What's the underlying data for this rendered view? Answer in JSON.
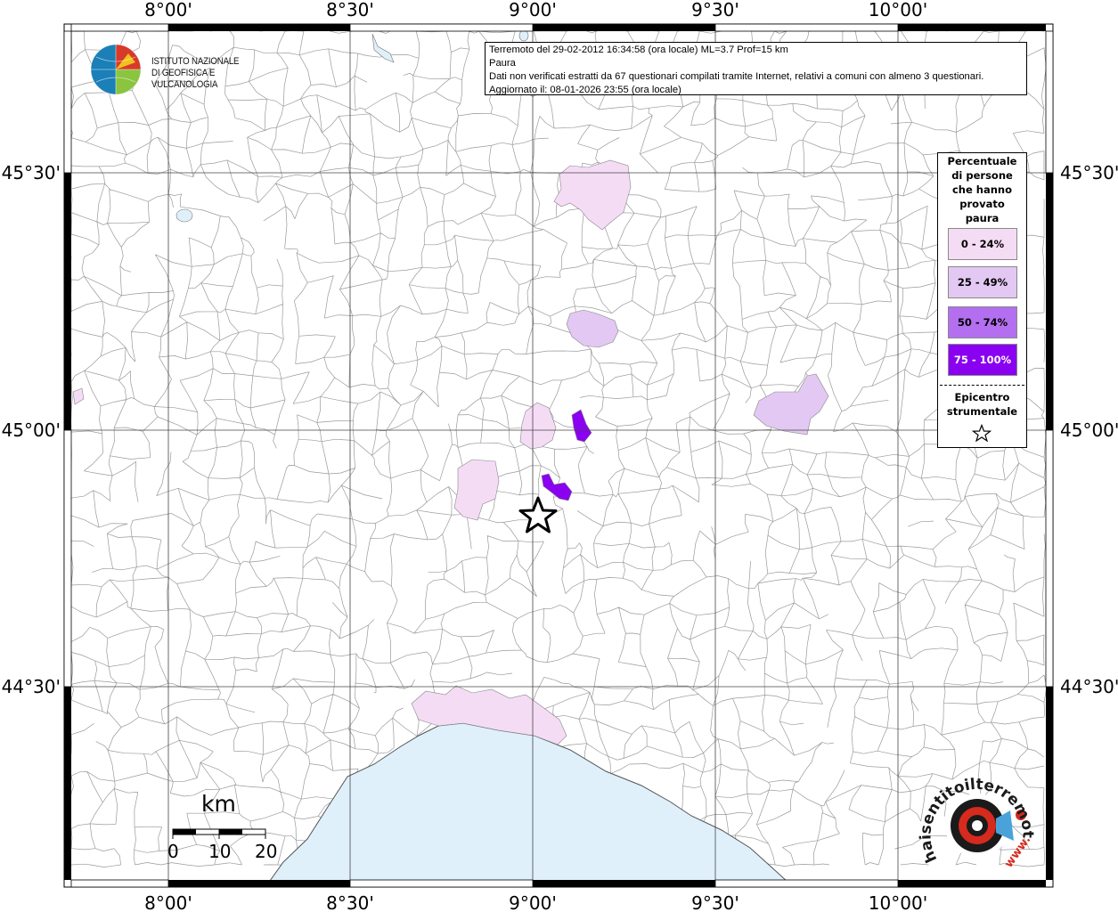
{
  "map": {
    "lon_labels": [
      "8°00'",
      "8°30'",
      "9°00'",
      "9°30'",
      "10°00'"
    ],
    "lat_labels": [
      "45°30'",
      "45°00'",
      "44°30'"
    ],
    "colors": {
      "sea": "#dff0fb",
      "land": "#ffffff",
      "class_0_24": "#f5dcf5",
      "class_25_49": "#e2c8f2",
      "class_50_74": "#b36ff0",
      "class_75_100": "#8a00f0",
      "boundary": "#9a9a9a"
    }
  },
  "info": {
    "line1": "Terremoto del 29-02-2012 16:34:58 (ora locale) ML=3.7 Prof=15 km",
    "line2": "Paura",
    "line3": "Dati non verificati estratti da 67 questionari compilati tramite Internet, relativi a comuni con almeno 3 questionari.",
    "line4": "Aggiornato il: 08-01-2026 23:55 (ora locale)"
  },
  "logo": {
    "line1": "ISTITUTO NAZIONALE",
    "line2": "DI GEOFISICA E VULCANOLOGIA"
  },
  "legend": {
    "title_lines": [
      "Percentuale",
      "di persone",
      "che hanno",
      "provato",
      "paura"
    ],
    "classes": [
      {
        "label": "0 - 24%",
        "color": "#f5dcf5",
        "text_color": "#000000"
      },
      {
        "label": "25 - 49%",
        "color": "#e2c8f2",
        "text_color": "#000000"
      },
      {
        "label": "50 - 74%",
        "color": "#b36ff0",
        "text_color": "#000000"
      },
      {
        "label": "75 - 100%",
        "color": "#8a00f0",
        "text_color": "#ffffff"
      }
    ],
    "epicenter_lines": [
      "Epicentro",
      "strumentale"
    ]
  },
  "scale": {
    "unit": "km",
    "ticks": [
      "0",
      "10",
      "20"
    ]
  },
  "hsit": {
    "main_text": "haisentitoilterremoto.it",
    "www_text": "www."
  }
}
